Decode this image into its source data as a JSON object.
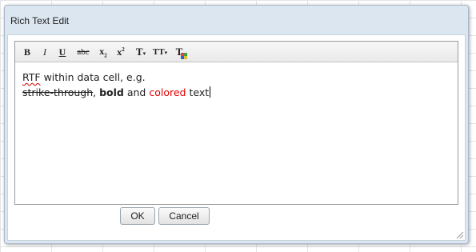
{
  "dialog": {
    "title": "Rich Text Edit",
    "colors": {
      "title_bar": "#dce6f0",
      "border": "#a8b8cc",
      "accent_red": "#e00000"
    }
  },
  "toolbar": {
    "buttons": [
      {
        "icon": "bold-icon",
        "glyph": "B"
      },
      {
        "icon": "italic-icon",
        "glyph": "I"
      },
      {
        "icon": "underline-icon",
        "glyph": "U"
      },
      {
        "icon": "strikethrough-icon",
        "glyph": "abc"
      },
      {
        "icon": "subscript-icon",
        "glyph": "x"
      },
      {
        "icon": "superscript-icon",
        "glyph": "x"
      },
      {
        "icon": "font-name-icon",
        "glyph": "T"
      },
      {
        "icon": "font-size-icon",
        "glyph": "TT"
      },
      {
        "icon": "font-color-icon",
        "glyph": "T"
      }
    ]
  },
  "editor": {
    "line1": {
      "misspelled": "RTF",
      "rest": " within data cell, e.g."
    },
    "line2": {
      "strike": "strike-through",
      "sep1": ", ",
      "bold": "bold",
      "and": " and ",
      "colored": "colored",
      "end": " text"
    }
  },
  "buttons": {
    "ok": "OK",
    "cancel": "Cancel"
  }
}
